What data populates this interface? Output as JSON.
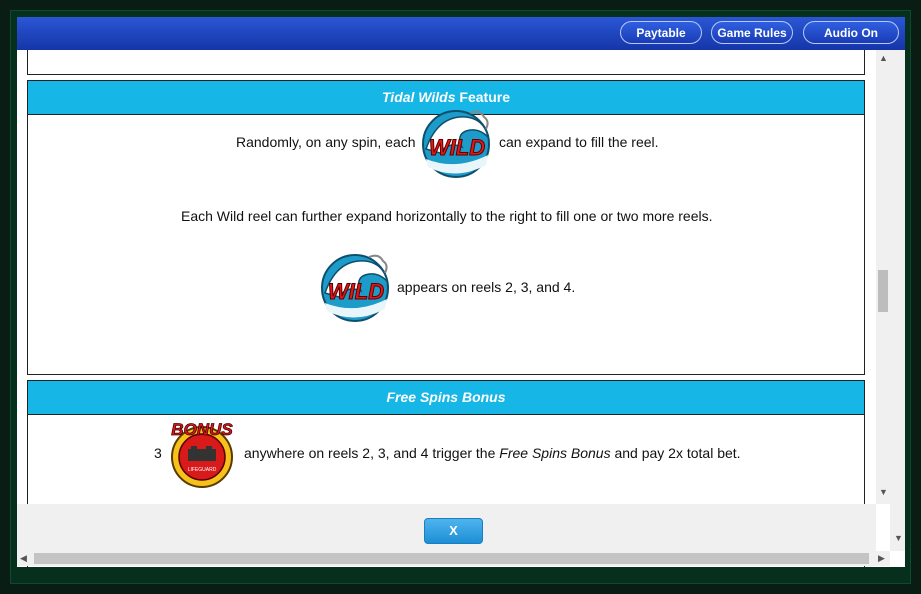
{
  "header": {
    "paytable_label": "Paytable",
    "game_rules_label": "Game Rules",
    "audio_label": "Audio On"
  },
  "tidal_wilds": {
    "title_italic": "Tidal Wilds",
    "title_plain": " Feature",
    "line1_before": "Randomly, on any spin, each",
    "line1_after": "can expand to fill the reel.",
    "line2": "Each Wild reel can further expand horizontally to the right to fill one or two more reels.",
    "line3_after": "appears on reels 2, 3, and 4.",
    "wild_symbol_text": "WILD"
  },
  "free_spins": {
    "title": "Free Spins Bonus",
    "count": "3",
    "text_before": "anywhere on reels 2, 3, and 4 trigger the",
    "text_italic": "Free Spins Bonus",
    "text_after": "and pay 2x total bet.",
    "bonus_symbol_text": "BONUS",
    "bonus_symbol_subtext": "LIFEGUARD"
  },
  "footer": {
    "close_label": "X"
  },
  "colors": {
    "section_header": "#16b6e6",
    "topbar": "#1f46c4",
    "close_button": "#2a9be0"
  }
}
